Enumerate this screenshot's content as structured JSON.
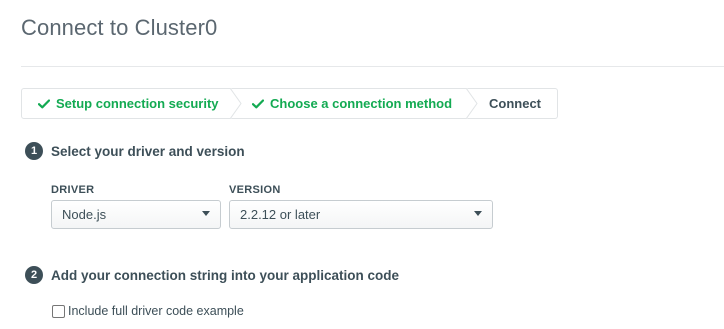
{
  "modal": {
    "title": "Connect to Cluster0"
  },
  "steps": [
    {
      "label": "Setup connection security",
      "status": "done",
      "icon": "checkmark-icon"
    },
    {
      "label": "Choose a connection method",
      "status": "done",
      "icon": "checkmark-icon"
    },
    {
      "label": "Connect",
      "status": "current"
    }
  ],
  "section1": {
    "number": "1",
    "title": "Select your driver and version",
    "driver_label": "DRIVER",
    "driver_value": "Node.js",
    "version_label": "VERSION",
    "version_value": "2.2.12 or later"
  },
  "section2": {
    "number": "2",
    "title": "Add your connection string into your application code",
    "checkbox_label": "Include full driver code example",
    "checkbox_checked": false
  },
  "colors": {
    "success": "#13aa52",
    "text": "#3d4f58",
    "title": "#5b6770"
  }
}
